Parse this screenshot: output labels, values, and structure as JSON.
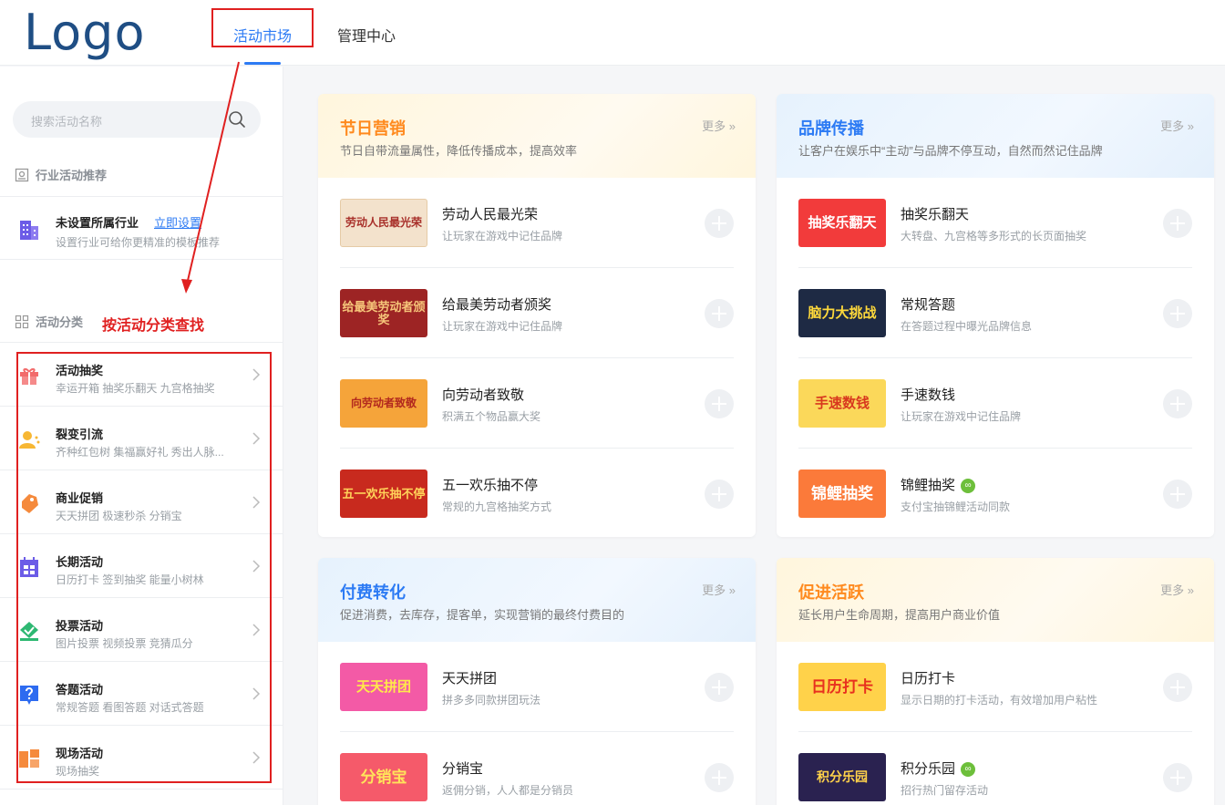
{
  "header": {
    "logo": "Logo",
    "tabs": [
      {
        "label": "活动市场",
        "active": true
      },
      {
        "label": "管理中心",
        "active": false
      }
    ]
  },
  "sidebar": {
    "search_placeholder": "搜索活动名称",
    "industry_section_title": "行业活动推荐",
    "industry": {
      "title": "未设置所属行业",
      "link": "立即设置",
      "subtitle": "设置行业可给你更精准的模板推荐"
    },
    "category_section_title": "活动分类",
    "annotation_note": "按活动分类查找",
    "categories": [
      {
        "title": "活动抽奖",
        "sub": "幸运开箱   抽奖乐翻天   九宫格抽奖",
        "icon": "gift-icon"
      },
      {
        "title": "裂变引流",
        "sub": "齐种红包树   集福赢好礼   秀出人脉...",
        "icon": "user-growth-icon"
      },
      {
        "title": "商业促销",
        "sub": "天天拼团   极速秒杀   分销宝",
        "icon": "price-tag-icon"
      },
      {
        "title": "长期活动",
        "sub": "日历打卡   签到抽奖   能量小树林",
        "icon": "calendar-icon"
      },
      {
        "title": "投票活动",
        "sub": "图片投票   视频投票   竞猜瓜分",
        "icon": "vote-check-icon"
      },
      {
        "title": "答题活动",
        "sub": "常规答题   看图答题   对话式答题",
        "icon": "question-icon"
      },
      {
        "title": "现场活动",
        "sub": "现场抽奖",
        "icon": "onsite-icon"
      }
    ]
  },
  "cards": [
    {
      "title": "节日营销",
      "desc": "节日自带流量属性，降低传播成本，提高效率",
      "more": "更多 »",
      "items": [
        {
          "title": "劳动人民最光荣",
          "sub": "让玩家在游戏中记住品牌",
          "thumb": "劳动人民最光荣"
        },
        {
          "title": "给最美劳动者颁奖",
          "sub": "让玩家在游戏中记住品牌",
          "thumb": "给最美劳动者颁奖"
        },
        {
          "title": "向劳动者致敬",
          "sub": "积满五个物品赢大奖",
          "thumb": "向劳动者致敬"
        },
        {
          "title": "五一欢乐抽不停",
          "sub": "常规的九宫格抽奖方式",
          "thumb": "五一欢乐抽不停"
        }
      ]
    },
    {
      "title": "品牌传播",
      "desc": "让客户在娱乐中“主动”与品牌不停互动，自然而然记住品牌",
      "more": "更多 »",
      "items": [
        {
          "title": "抽奖乐翻天",
          "sub": "大转盘、九宫格等多形式的长页面抽奖",
          "thumb": "抽奖乐翻天"
        },
        {
          "title": "常规答题",
          "sub": "在答题过程中曝光品牌信息",
          "thumb": "脑力大挑战"
        },
        {
          "title": "手速数钱",
          "sub": "让玩家在游戏中记住品牌",
          "thumb": "手速数钱"
        },
        {
          "title": "锦鲤抽奖",
          "sub": "支付宝抽锦鲤活动同款",
          "thumb": "锦鲤抽奖",
          "badge": "mini-program-icon"
        }
      ]
    },
    {
      "title": "付费转化",
      "desc": "促进消费，去库存，提客单，实现营销的最终付费目的",
      "more": "更多 »",
      "items": [
        {
          "title": "天天拼团",
          "sub": "拼多多同款拼团玩法",
          "thumb": "天天拼团"
        },
        {
          "title": "分销宝",
          "sub": "返佣分销，人人都是分销员",
          "thumb": "分销宝"
        }
      ]
    },
    {
      "title": "促进活跃",
      "desc": "延长用户生命周期，提高用户商业价值",
      "more": "更多 »",
      "items": [
        {
          "title": "日历打卡",
          "sub": "显示日期的打卡活动，有效增加用户粘性",
          "thumb": "日历打卡"
        },
        {
          "title": "积分乐园",
          "sub": "招行热门留存活动",
          "thumb": "积分乐园",
          "badge": "mini-program-icon"
        }
      ]
    }
  ]
}
